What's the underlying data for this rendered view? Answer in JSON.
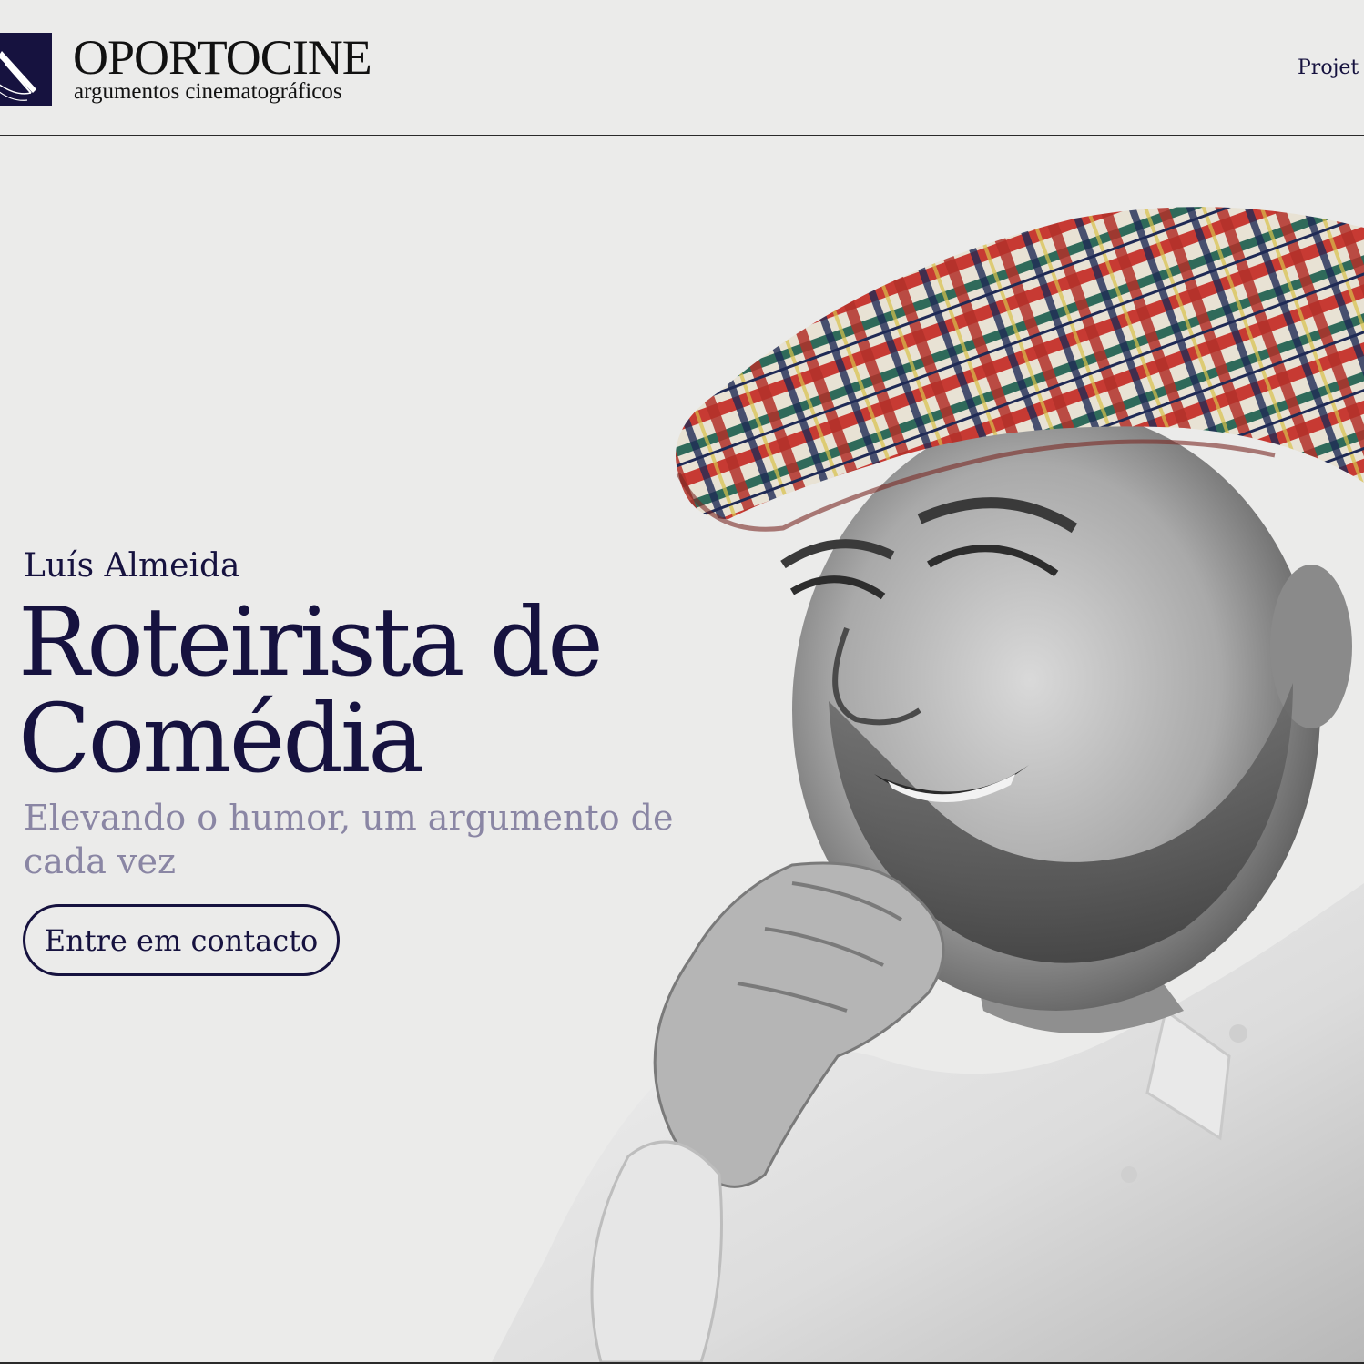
{
  "header": {
    "brand_name": "OPORTOCINE",
    "brand_tagline": "argumentos cinematográficos",
    "nav_items": [
      {
        "label": "Projet"
      }
    ]
  },
  "hero": {
    "name": "Luís Almeida",
    "title_line1": "Roteirista de",
    "title_line2": "Comédia",
    "subtitle": "Elevando o humor, um argumento de cada vez",
    "cta_label": "Entre em contacto",
    "photo_description_icon": "portrait-photo"
  },
  "colors": {
    "background": "#ebebea",
    "primary": "#16123f",
    "subtitle": "#8a86a4",
    "text_dark": "#111111"
  }
}
